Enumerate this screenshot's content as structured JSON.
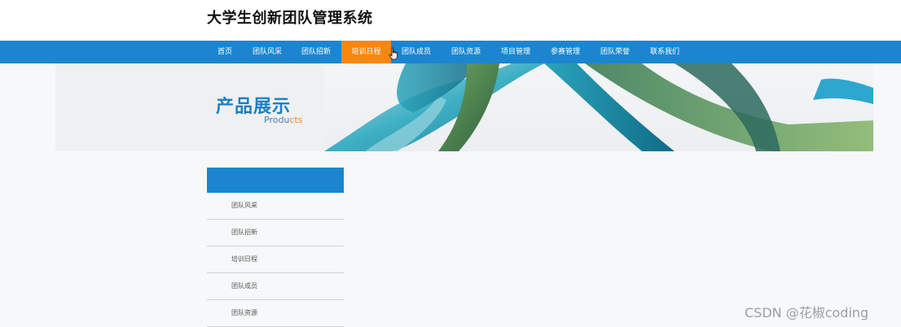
{
  "site": {
    "title": "大学生创新团队管理系统"
  },
  "nav": {
    "items": [
      {
        "label": "首页",
        "active": false
      },
      {
        "label": "团队风采",
        "active": false
      },
      {
        "label": "团队招新",
        "active": false
      },
      {
        "label": "培训日程",
        "active": true
      },
      {
        "label": "团队成员",
        "active": false
      },
      {
        "label": "团队资源",
        "active": false
      },
      {
        "label": "项目管理",
        "active": false
      },
      {
        "label": "参赛管理",
        "active": false
      },
      {
        "label": "团队荣誉",
        "active": false
      },
      {
        "label": "联系我们",
        "active": false
      }
    ]
  },
  "banner": {
    "title_cn": "产品展示",
    "title_en_main": "Produ",
    "title_en_accent": "cts"
  },
  "sidebar": {
    "header": "",
    "items": [
      {
        "label": "团队风采"
      },
      {
        "label": "团队招新"
      },
      {
        "label": "培训日程"
      },
      {
        "label": "团队成员"
      },
      {
        "label": "团队资源"
      }
    ]
  },
  "watermark": {
    "text": "CSDN @花椒coding"
  },
  "colors": {
    "nav_bg": "#1b86cf",
    "nav_active": "#f7870f",
    "title_blue": "#1d7fc4",
    "accent_orange": "#f58a1f"
  },
  "icons": {
    "cursor": "hand-pointer-icon"
  }
}
